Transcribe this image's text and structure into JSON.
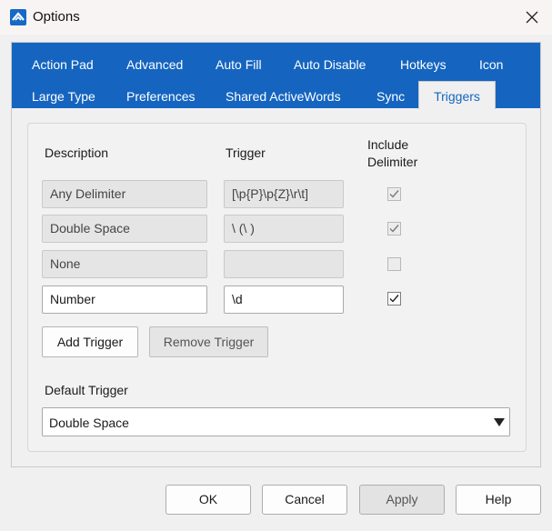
{
  "window": {
    "title": "Options",
    "icon": "activewords-logo-icon",
    "close_icon": "close-icon"
  },
  "tabs": {
    "row1": [
      "Action Pad",
      "Advanced",
      "Auto Fill",
      "Auto Disable",
      "Hotkeys",
      "Icon"
    ],
    "row2": [
      "Large Type",
      "Preferences",
      "Shared ActiveWords",
      "Sync",
      "Triggers"
    ],
    "active": "Triggers"
  },
  "columns": {
    "description": "Description",
    "trigger": "Trigger",
    "include_line1": "Include",
    "include_line2": "Delimiter"
  },
  "rows": [
    {
      "description": "Any Delimiter",
      "trigger": "[\\p{P}\\p{Z}\\r\\t]",
      "include_delimiter": true,
      "editable": false
    },
    {
      "description": "Double Space",
      "trigger": "\\ (\\ )",
      "include_delimiter": true,
      "editable": false
    },
    {
      "description": "None",
      "trigger": "",
      "include_delimiter": false,
      "editable": false
    },
    {
      "description": "Number",
      "trigger": "\\d",
      "include_delimiter": true,
      "editable": true
    }
  ],
  "buttons": {
    "add": "Add Trigger",
    "remove": "Remove Trigger"
  },
  "default_trigger": {
    "label": "Default Trigger",
    "value": "Double Space",
    "arrow_icon": "dropdown-arrow-icon"
  },
  "footer": {
    "ok": "OK",
    "cancel": "Cancel",
    "apply": "Apply",
    "help": "Help"
  },
  "colors": {
    "tab_band": "#1565c0",
    "app_icon": "#1769c7",
    "window_bg": "#f0f0f0"
  }
}
